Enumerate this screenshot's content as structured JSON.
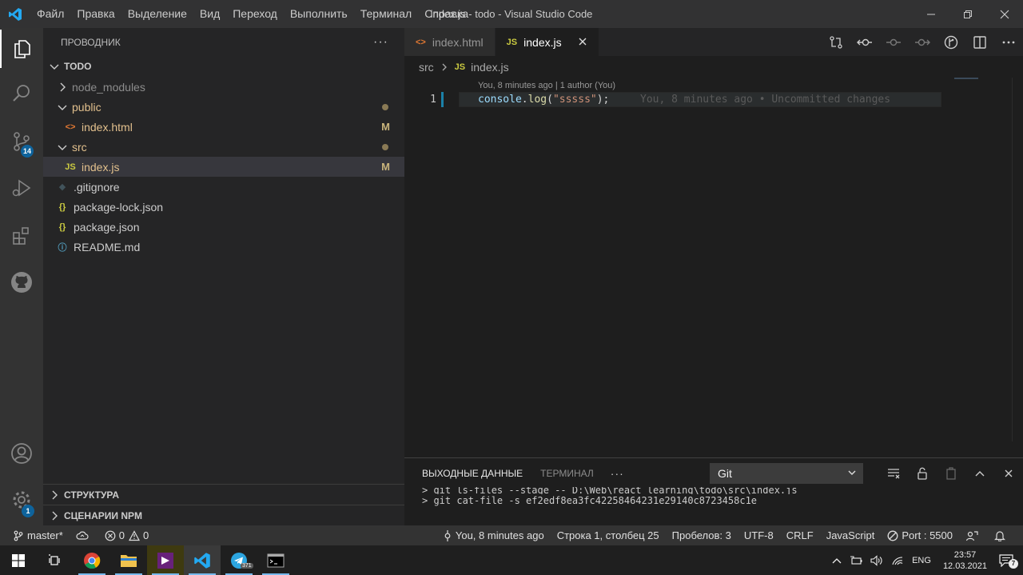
{
  "window": {
    "title": "index.js - todo - Visual Studio Code",
    "menu": [
      "Файл",
      "Правка",
      "Выделение",
      "Вид",
      "Переход",
      "Выполнить",
      "Терминал",
      "Справка"
    ]
  },
  "activity": {
    "scm_badge": "14",
    "settings_badge": "1"
  },
  "sidebar": {
    "header": "ПРОВОДНИК",
    "more": "···",
    "root": "TODO",
    "tree": [
      {
        "label": "node_modules",
        "type": "folder",
        "expanded": false,
        "indent": 1
      },
      {
        "label": "public",
        "type": "folder",
        "expanded": true,
        "indent": 1,
        "modified": true
      },
      {
        "label": "index.html",
        "type": "html",
        "indent": 2,
        "status": "M"
      },
      {
        "label": "src",
        "type": "folder",
        "expanded": true,
        "indent": 1,
        "modified": true
      },
      {
        "label": "index.js",
        "type": "js",
        "indent": 2,
        "status": "M",
        "selected": true
      },
      {
        "label": ".gitignore",
        "type": "git",
        "indent": 1
      },
      {
        "label": "package-lock.json",
        "type": "json",
        "indent": 1
      },
      {
        "label": "package.json",
        "type": "json",
        "indent": 1
      },
      {
        "label": "README.md",
        "type": "info",
        "indent": 1
      }
    ],
    "bottom_sections": [
      "СТРУКТУРА",
      "СЦЕНАРИИ NPM"
    ]
  },
  "editor": {
    "tabs": [
      {
        "label": "index.html",
        "icon": "<>",
        "active": false
      },
      {
        "label": "index.js",
        "icon": "JS",
        "active": true
      }
    ],
    "breadcrumb": {
      "folder": "src",
      "file_icon": "JS",
      "file": "index.js"
    },
    "codelens": "You, 8 minutes ago | 1 author (You)",
    "line_number": "1",
    "code": {
      "ident": "console",
      "dot": ".",
      "fn": "log",
      "open": "(",
      "str": "\"sssss\"",
      "close": ");"
    },
    "blame": "You, 8 minutes ago • Uncommitted changes"
  },
  "panel": {
    "tab_output": "ВЫХОДНЫЕ ДАННЫЕ",
    "tab_terminal": "ТЕРМИНАЛ",
    "more": "···",
    "channel": "Git",
    "lines": [
      "> git ls-files --stage -- D:\\Web\\react_learning\\todo\\src\\index.js",
      "> git cat-file -s ef2edf8ea3fc42258464231e29140c8723458c1e"
    ]
  },
  "status": {
    "branch": "master*",
    "errors": "0",
    "warnings": "0",
    "blame": "You, 8 minutes ago",
    "position": "Строка 1, столбец 25",
    "spaces": "Пробелов: 3",
    "encoding": "UTF-8",
    "eol": "CRLF",
    "language": "JavaScript",
    "port": "Port : 5500"
  },
  "taskbar": {
    "lang": "ENG",
    "time": "23:57",
    "date": "12.03.2021",
    "telegram_badge": "371",
    "notif_count": "7"
  }
}
